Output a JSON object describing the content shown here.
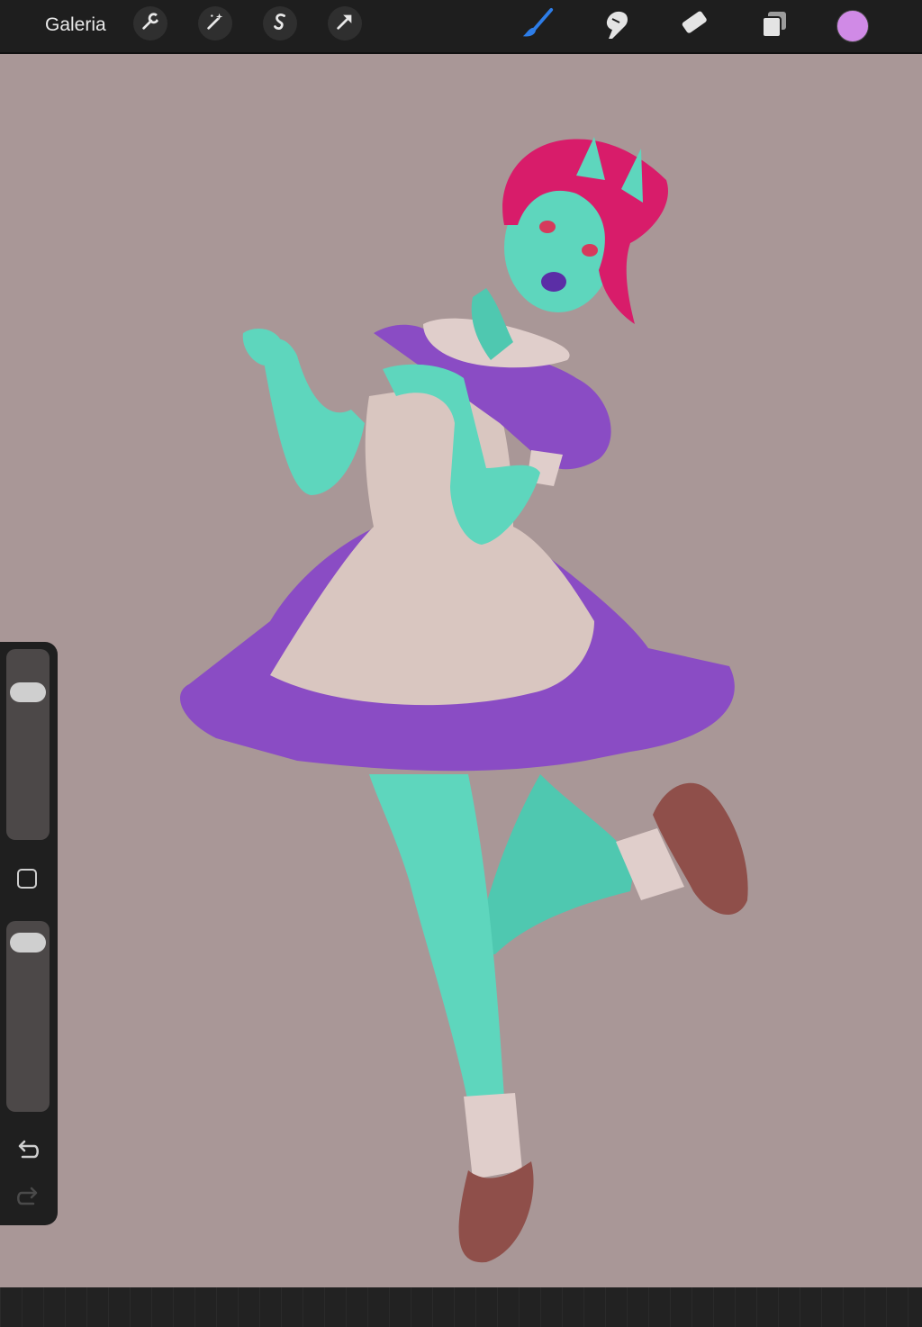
{
  "app": {
    "gallery_label": "Galeria"
  },
  "toolbar_left": [
    {
      "name": "actions",
      "icon": "wrench-icon"
    },
    {
      "name": "adjustments",
      "icon": "magic-wand-icon"
    },
    {
      "name": "selection",
      "icon": "selection-s-icon"
    },
    {
      "name": "transform",
      "icon": "arrow-cursor-icon"
    }
  ],
  "toolbar_right": [
    {
      "name": "brush",
      "icon": "brush-icon",
      "active": true
    },
    {
      "name": "smudge",
      "icon": "smudge-finger-icon"
    },
    {
      "name": "eraser",
      "icon": "eraser-icon"
    },
    {
      "name": "layers",
      "icon": "layers-icon"
    }
  ],
  "current_color": "#d08ae6",
  "colors": {
    "topbar": "#1e1e1e",
    "canvas_bg": "#a99797",
    "brush_active": "#2d7de8",
    "skin": "#5ed6bd",
    "hair": "#d81c6a",
    "dress": "#8a4cc4",
    "apron": "#d9c6c0",
    "shoes": "#8f4f4a"
  },
  "sidebar": {
    "brush_size_level": 0.82,
    "opacity_level": 0.95
  },
  "canvas": {
    "subject": "illustration"
  }
}
